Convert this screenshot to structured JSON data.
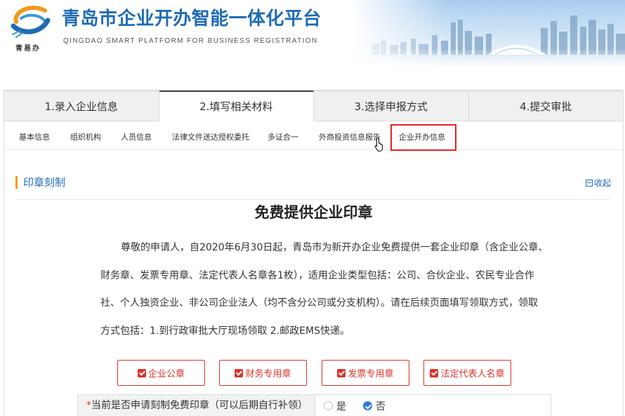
{
  "header": {
    "logo_caption": "青易办",
    "title": "青岛市企业开办智能一体化平台",
    "subtitle": "QINGDAO SMART PLATFORM FOR BUSINESS REGISTRATION"
  },
  "steps": [
    {
      "label": "1.录入企业信息",
      "active": false
    },
    {
      "label": "2.填写相关材料",
      "active": true
    },
    {
      "label": "3.选择申报方式",
      "active": false
    },
    {
      "label": "4.提交审批",
      "active": false
    }
  ],
  "subtabs": [
    "基本信息",
    "组织机构",
    "人员信息",
    "法律文件送达授权委托",
    "多证合一",
    "外商投资信息报告",
    "企业开办信息"
  ],
  "section": {
    "title": "印章刻制",
    "collapse_label": "收起"
  },
  "notice": {
    "heading": "免费提供企业印章",
    "lines": [
      "尊敬的申请人，自2020年6月30日起，青岛市为新开办企业免费提供一套企业印章（含企业公章、",
      "财务章、发票专用章、法定代表人名章各1枚），适用企业类型包括：公司、合伙企业、农民专业合作",
      "社、个人独资企业、非公司企业法人（均不含分公司或分支机构）。请在后续页面填写领取方式，领取",
      "方式包括：1.到行政审批大厅现场领取 2.邮政EMS快递。"
    ]
  },
  "seal_options": [
    "企业公章",
    "财务专用章",
    "发票专用章",
    "法定代表人名章"
  ],
  "apply_question": {
    "required_mark": "*",
    "label": "当前是否申请刻制免费印章（可以后期自行补领）",
    "options": [
      {
        "label": "是",
        "checked": false
      },
      {
        "label": "否",
        "checked": true
      }
    ]
  },
  "icons": {
    "logo": "swirl-logo-icon",
    "banner": "city-skyline-image",
    "collapse": "squared-minus-icon",
    "seal_option": "checked-checkbox-icon",
    "radio_checked": "checked-radio-icon",
    "cursor": "hand-pointer-icon"
  },
  "colors": {
    "brand_blue": "#1f6cb5",
    "accent_orange": "#f29a1b",
    "seal_red": "#d9342b",
    "highlight_red": "#e02424",
    "radio_blue": "#2d7be0"
  }
}
